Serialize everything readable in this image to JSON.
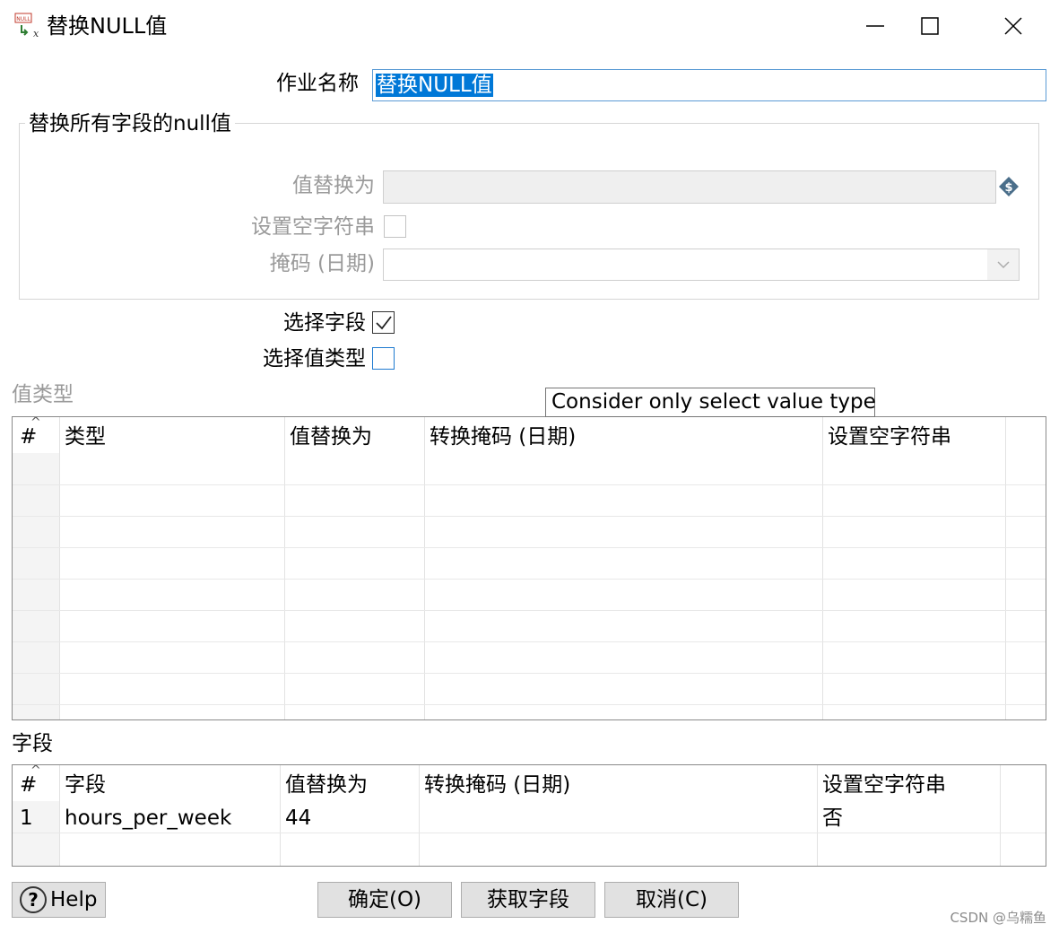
{
  "window": {
    "title": "替换NULL值",
    "icon": "null-replace-icon",
    "icon_text": "NULL",
    "controls": [
      "minimize-icon",
      "maximize-icon",
      "close-icon"
    ]
  },
  "job_name": {
    "label": "作业名称",
    "value": "替换NULL值"
  },
  "replace_all_group": {
    "title": "替换所有字段的null值",
    "replace_with_label": "值替换为",
    "replace_with_value": "",
    "set_empty_label": "设置空字符串",
    "set_empty_checked": false,
    "mask_label": "掩码 (日期)",
    "mask_value": ""
  },
  "options": {
    "select_fields_label": "选择字段",
    "select_fields_checked": true,
    "select_value_types_label": "选择值类型",
    "select_value_types_checked": false
  },
  "tooltip": "Consider only select value type",
  "value_types_table": {
    "title": "值类型",
    "columns": [
      "#",
      "类型",
      "值替换为",
      "转换掩码 (日期)",
      "设置空字符串"
    ],
    "rows": []
  },
  "fields_table": {
    "title": "字段",
    "columns": [
      "#",
      "字段",
      "值替换为",
      "转换掩码 (日期)",
      "设置空字符串"
    ],
    "rows": [
      {
        "num": "1",
        "field": "hours_per_week",
        "replace_with": "44",
        "mask": "",
        "set_empty": "否"
      }
    ]
  },
  "buttons": {
    "help": "Help",
    "ok": "确定(O)",
    "get_fields": "获取字段",
    "cancel": "取消(C)"
  },
  "watermark": "CSDN @乌糯鱼",
  "colors": {
    "accent": "#0078d7",
    "focus_border": "#5b9bd5",
    "disabled_text": "#9a9a9a",
    "button_bg": "#e1e1e1"
  }
}
